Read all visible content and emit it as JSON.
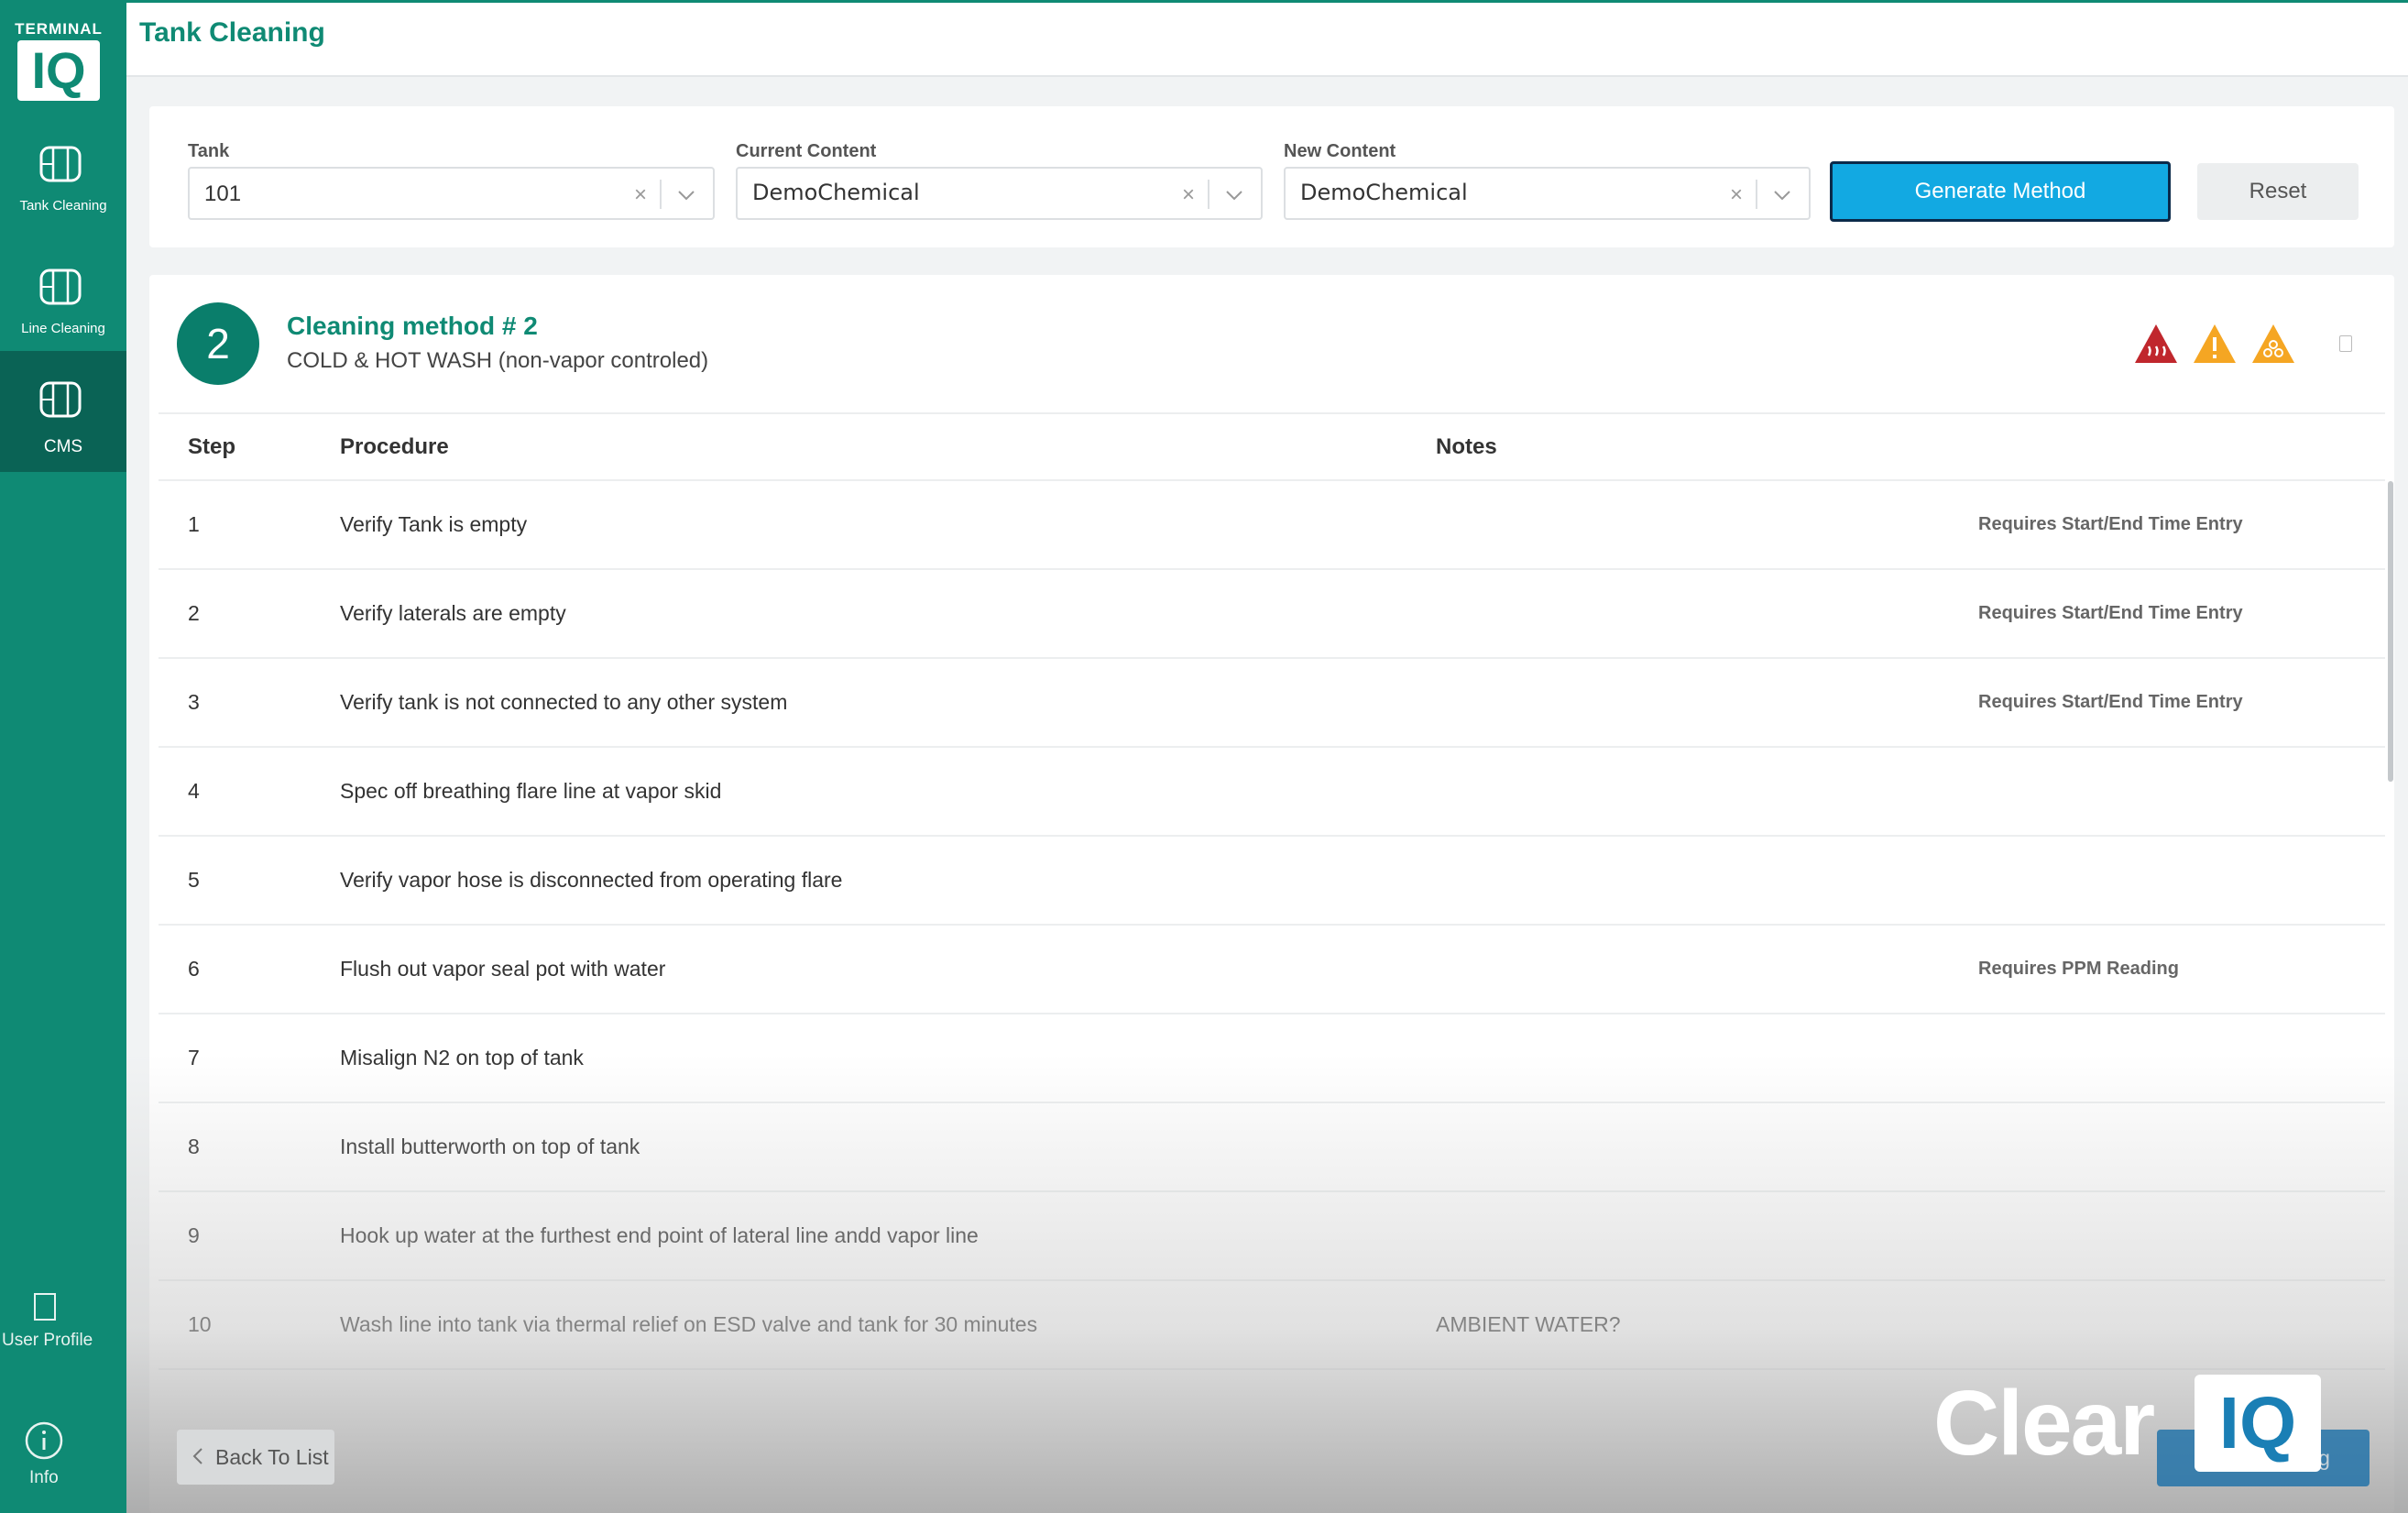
{
  "sidebar": {
    "logo_top": "TERMINAL",
    "logo_main": "IQ",
    "items": [
      {
        "label": "Tank Cleaning"
      },
      {
        "label": "Line Cleaning"
      },
      {
        "label": "CMS"
      }
    ],
    "user_profile": "User Profile",
    "info": "Info"
  },
  "header": {
    "title": "Tank Cleaning"
  },
  "filters": {
    "tank": {
      "label": "Tank",
      "value": "101"
    },
    "current_content": {
      "label": "Current Content",
      "value": "DemoChemical"
    },
    "new_content": {
      "label": "New Content",
      "value": "DemoChemical"
    },
    "clear_glyph": "×",
    "generate_label": "Generate Method",
    "reset_label": "Reset"
  },
  "method": {
    "number": "2",
    "title": "Cleaning method # 2",
    "subtitle": "COLD & HOT WASH (non-vapor controled)",
    "hazard_icons": [
      "heat-hazard-icon",
      "warning-hazard-icon",
      "toxic-hazard-icon"
    ],
    "hazard_colors": [
      "#c0272d",
      "#f5a623",
      "#f5a623"
    ]
  },
  "table": {
    "headers": {
      "step": "Step",
      "procedure": "Procedure",
      "notes": "Notes"
    },
    "rows": [
      {
        "step": "1",
        "procedure": "Verify Tank is empty",
        "notes": "",
        "requirement": "Requires Start/End Time Entry"
      },
      {
        "step": "2",
        "procedure": "Verify laterals are empty",
        "notes": "",
        "requirement": "Requires Start/End Time Entry"
      },
      {
        "step": "3",
        "procedure": "Verify tank is not connected to any other system",
        "notes": "",
        "requirement": "Requires Start/End Time Entry"
      },
      {
        "step": "4",
        "procedure": "Spec off breathing flare line at vapor skid",
        "notes": "",
        "requirement": ""
      },
      {
        "step": "5",
        "procedure": "Verify vapor hose is disconnected from operating flare",
        "notes": "",
        "requirement": ""
      },
      {
        "step": "6",
        "procedure": "Flush out vapor seal pot with water",
        "notes": "",
        "requirement": "Requires PPM Reading"
      },
      {
        "step": "7",
        "procedure": "Misalign N2 on top of tank",
        "notes": "",
        "requirement": ""
      },
      {
        "step": "8",
        "procedure": "Install butterworth on top of tank",
        "notes": "",
        "requirement": ""
      },
      {
        "step": "9",
        "procedure": "Hook up water at the furthest end point of lateral line andd vapor line",
        "notes": "",
        "requirement": ""
      },
      {
        "step": "10",
        "procedure": "Wash line into tank via thermal relief on ESD valve and tank for 30 minutes",
        "notes": "AMBIENT WATER?",
        "requirement": ""
      }
    ]
  },
  "footer": {
    "back_label": "Back To List",
    "start_label": "Start Cleaning"
  },
  "watermark": {
    "word": "Clear",
    "badge": "IQ"
  },
  "colors": {
    "sidebar": "#0f8a74",
    "sidebar_active": "#0a6355",
    "accent": "#0f8a74",
    "primary_button": "#12a9e2"
  }
}
